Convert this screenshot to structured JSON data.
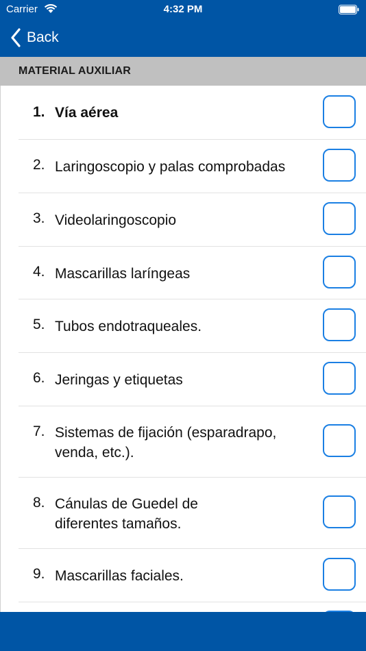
{
  "status_bar": {
    "carrier": "Carrier",
    "time": "4:32 PM"
  },
  "nav": {
    "back_label": "Back"
  },
  "section": {
    "title": "MATERIAL AUXILIAR"
  },
  "items": [
    {
      "number": "1.",
      "label": "Vía aérea",
      "checked": false
    },
    {
      "number": "2.",
      "label": "Laringoscopio y palas comprobadas",
      "checked": false
    },
    {
      "number": "3.",
      "label": "Videolaringoscopio",
      "checked": false
    },
    {
      "number": "4.",
      "label": "Mascarillas laríngeas",
      "checked": false
    },
    {
      "number": "5.",
      "label": "Tubos endotraqueales.",
      "checked": false
    },
    {
      "number": "6.",
      "label": "Jeringas y etiquetas",
      "checked": false
    },
    {
      "number": "7.",
      "label": "Sistemas de fijación (esparadrapo, venda, etc.).",
      "checked": false
    },
    {
      "number": "8.",
      "label": "Cánulas de Guedel de diferentes tamaños.",
      "checked": false
    },
    {
      "number": "9.",
      "label": "Mascarillas faciales.",
      "checked": false
    }
  ],
  "colors": {
    "nav_bg": "#0055a5",
    "checkbox_border": "#1a7fe3",
    "section_bg": "#c0c0c0"
  }
}
